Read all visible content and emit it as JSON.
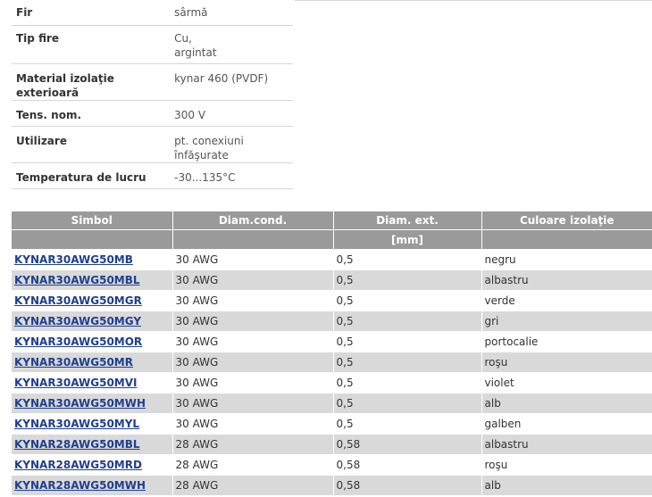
{
  "specs": [
    {
      "key": "Fir",
      "value": [
        "sârmă"
      ]
    },
    {
      "key": "Tip fire",
      "value": [
        "Cu,",
        "argintat"
      ]
    },
    {
      "key": "Material izolaţie exterioară",
      "value": [
        "kynar 460 (PVDF)"
      ]
    },
    {
      "key": "Tens. nom.",
      "value": [
        "300 V"
      ]
    },
    {
      "key": "Utilizare",
      "value": [
        "pt. conexiuni înfăşurate"
      ]
    },
    {
      "key": "Temperatura de lucru",
      "value": [
        "-30...135°C"
      ]
    }
  ],
  "table": {
    "headers": [
      "Simbol",
      "Diam.cond.",
      "Diam. ext.",
      "Culoare izolaţie"
    ],
    "units": [
      "",
      "",
      "[mm]",
      ""
    ],
    "rows": [
      {
        "symbol": "KYNAR30AWG50MB",
        "diam_cond": "30 AWG",
        "diam_ext": "0,5",
        "color": "negru"
      },
      {
        "symbol": "KYNAR30AWG50MBL",
        "diam_cond": "30 AWG",
        "diam_ext": "0,5",
        "color": "albastru"
      },
      {
        "symbol": "KYNAR30AWG50MGR",
        "diam_cond": "30 AWG",
        "diam_ext": "0,5",
        "color": "verde"
      },
      {
        "symbol": "KYNAR30AWG50MGY",
        "diam_cond": "30 AWG",
        "diam_ext": "0,5",
        "color": "gri"
      },
      {
        "symbol": "KYNAR30AWG50MOR",
        "diam_cond": "30 AWG",
        "diam_ext": "0,5",
        "color": "portocalie"
      },
      {
        "symbol": "KYNAR30AWG50MR",
        "diam_cond": "30 AWG",
        "diam_ext": "0,5",
        "color": "roşu"
      },
      {
        "symbol": "KYNAR30AWG50MVI",
        "diam_cond": "30 AWG",
        "diam_ext": "0,5",
        "color": "violet"
      },
      {
        "symbol": "KYNAR30AWG50MWH",
        "diam_cond": "30 AWG",
        "diam_ext": "0,5",
        "color": "alb"
      },
      {
        "symbol": "KYNAR30AWG50MYL",
        "diam_cond": "30 AWG",
        "diam_ext": "0,5",
        "color": "galben"
      },
      {
        "symbol": "KYNAR28AWG50MBL",
        "diam_cond": "28 AWG",
        "diam_ext": "0,58",
        "color": "albastru"
      },
      {
        "symbol": "KYNAR28AWG50MRD",
        "diam_cond": "28 AWG",
        "diam_ext": "0,58",
        "color": "roşu"
      },
      {
        "symbol": "KYNAR28AWG50MWH",
        "diam_cond": "28 AWG",
        "diam_ext": "0,58",
        "color": "alb"
      }
    ]
  },
  "colors": {
    "header_bg": "#9a9a9a",
    "stripe_bg": "#d9d9d9",
    "link": "#1f3f8f"
  }
}
